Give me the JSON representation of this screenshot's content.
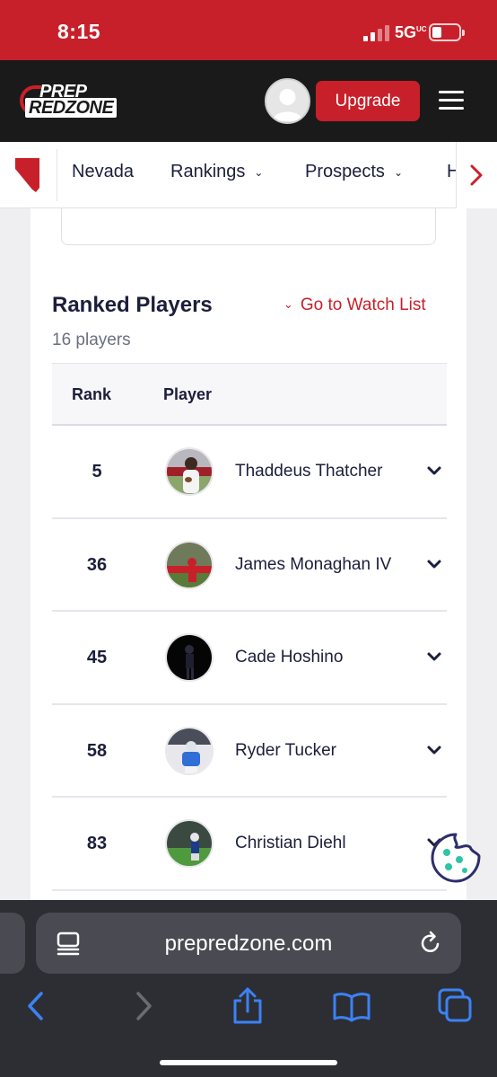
{
  "status_bar": {
    "time": "8:15",
    "network": "5G",
    "network_suffix": "UC"
  },
  "header": {
    "logo_top": "PREP",
    "logo_bottom": "REDZONE",
    "upgrade_label": "Upgrade"
  },
  "nav": {
    "state": "Nevada",
    "rankings": "Rankings",
    "prospects": "Prospects",
    "next_partial": "H"
  },
  "section": {
    "title": "Ranked Players",
    "watch_link": "Go to Watch List",
    "count": "16 players"
  },
  "table": {
    "headers": {
      "rank": "Rank",
      "player": "Player"
    },
    "rows": [
      {
        "rank": "5",
        "name": "Thaddeus Thatcher"
      },
      {
        "rank": "36",
        "name": "James Monaghan IV"
      },
      {
        "rank": "45",
        "name": "Cade Hoshino"
      },
      {
        "rank": "58",
        "name": "Ryder Tucker"
      },
      {
        "rank": "83",
        "name": "Christian Diehl"
      }
    ]
  },
  "browser": {
    "url": "prepredzone.com"
  },
  "icons": {
    "state": "nevada-state-icon",
    "menu": "hamburger-icon",
    "expand": "chevron-down-icon",
    "cookie": "cookie-icon",
    "back": "back-icon",
    "forward": "forward-icon",
    "share": "share-icon",
    "bookmarks": "bookmarks-icon",
    "tabs": "tabs-icon"
  },
  "colors": {
    "brand_red": "#c8202a",
    "header_dark": "#1a1a1a",
    "text_navy": "#1b1f3b",
    "browser_blue": "#3b82f6",
    "cookie_teal": "#2ec4a6"
  }
}
